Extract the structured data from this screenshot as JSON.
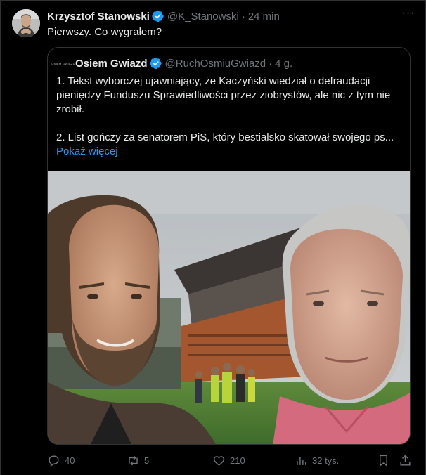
{
  "author": {
    "name": "Krzysztof Stanowski",
    "handle": "@K_Stanowski",
    "separator": "·",
    "time": "24 min"
  },
  "tweet_text": "Pierwszy. Co wygrałem?",
  "more_label": "···",
  "quoted": {
    "name": "Osiem Gwiazd",
    "handle": "@RuchOsmiuGwiazd",
    "separator": "·",
    "time": "4 g.",
    "paragraph1": "1. Tekst wyborczej ujawniający, że Kaczyński wiedział o defraudacji pieniędzy Funduszu Sprawiedliwości przez ziobrystów, ale nic z tym nie zrobił.",
    "paragraph2": "2. List gończy za senatorem PiS, który bestialsko skatował swojego ps...",
    "show_more": "Pokaż więcej",
    "avatar_text": "OSIEM GWIAZD"
  },
  "actions": {
    "replies": "40",
    "retweets": "5",
    "likes": "210",
    "views": "32 tys."
  },
  "colors": {
    "background": "#000000",
    "text": "#e7e9ea",
    "muted": "#71767b",
    "link": "#1d9bf0",
    "border": "#2f3336",
    "verified": "#1d9bf0"
  },
  "icons": [
    "verified-badge-icon",
    "more-icon",
    "reply-icon",
    "retweet-icon",
    "like-icon",
    "views-icon",
    "bookmark-icon",
    "share-icon"
  ]
}
